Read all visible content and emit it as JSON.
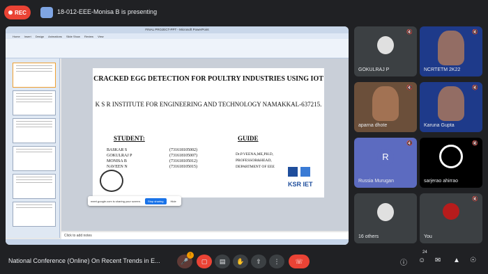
{
  "topbar": {
    "rec_label": "REC",
    "presenter_text": "18-012-EEE-Monisa B is presenting"
  },
  "presentation": {
    "window_title": "FINAL PROJECT-PPT - Microsoft PowerPoint",
    "ribbon_tabs": [
      "Home",
      "Insert",
      "Design",
      "Animations",
      "Slide Show",
      "Review",
      "View"
    ],
    "slide": {
      "title": "CRACKED EGG DETECTION FOR POULTRY INDUSTRIES USING IOT",
      "institute": "K S R INSTITUTE FOR ENGINEERING AND TECHNOLOGY NAMAKKAL-637215.",
      "student_heading": "STUDENT:",
      "guide_heading": "GUIDE",
      "students": [
        {
          "name": "BASKAR S",
          "id": "(731618105002)"
        },
        {
          "name": "GOKULRAJ P",
          "id": "(731618105007)"
        },
        {
          "name": "MONISA B",
          "id": "(731618105012)"
        },
        {
          "name": "NAVEEN N",
          "id": "(731618105015)"
        }
      ],
      "guide_lines": [
        "Dr.P.VEENA,ME,PH.D,",
        "PROFESSOR&HEAD,",
        "DEPARTMENT OF EEE"
      ],
      "logo_right_text": "KSR IET"
    },
    "notes_placeholder": "Click to add notes",
    "share_tip": {
      "text": "meet.google.com is sharing your screen.",
      "stop": "Stop sharing",
      "hide": "Hide"
    }
  },
  "participants": [
    {
      "name": "GOKULRAJ P",
      "initial": "",
      "bg": "#3c4043"
    },
    {
      "name": "NCRTETM 2K22",
      "initial": "",
      "bg": "#1e3a8a"
    },
    {
      "name": "aparna dhote",
      "initial": "",
      "bg": "#6b4f3a"
    },
    {
      "name": "Karuna Gupta",
      "initial": "",
      "bg": "#1e3a8a"
    },
    {
      "name": "Russia Murugan",
      "initial": "R",
      "bg": "#5c6bc0"
    },
    {
      "name": "sarjerao ahirrao",
      "initial": "",
      "bg": "#000000"
    },
    {
      "name": "16 others",
      "initial": "",
      "bg": "#3c4043"
    },
    {
      "name": "You",
      "initial": "",
      "bg": "#3c4043"
    }
  ],
  "bottom": {
    "meeting_title": "National Conference (Online) On Recent Trends in E...",
    "participant_count": "24",
    "mic_badge": "!"
  }
}
